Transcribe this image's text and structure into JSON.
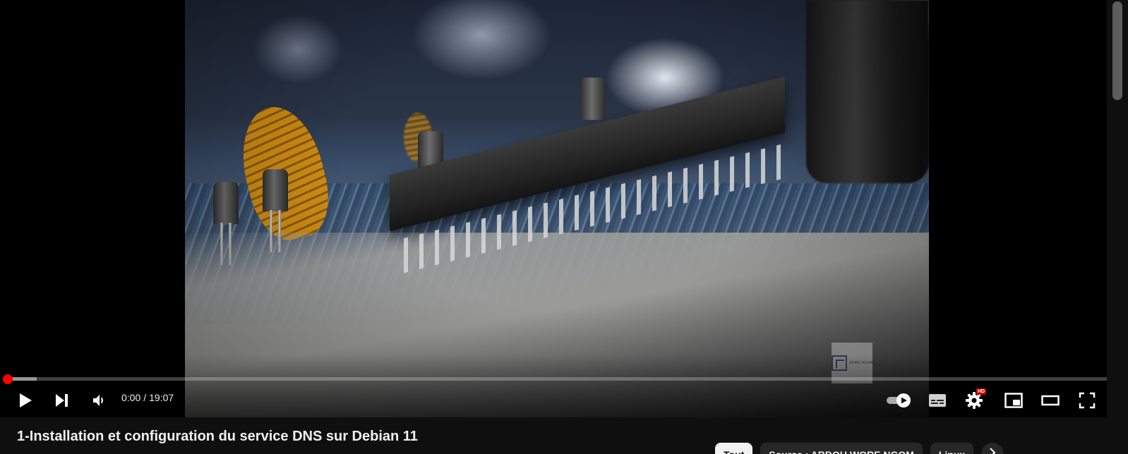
{
  "player": {
    "time_current": "0:00",
    "time_separator": "/",
    "time_total": "19:07",
    "progress_played": 0.004,
    "progress_buffered": 0.026,
    "settings_badge": "HD",
    "accent_color": "#ff0000"
  },
  "video": {
    "title": "1-Installation et configuration du service DNS sur Debian 11"
  },
  "chips": [
    {
      "label": "Tout",
      "active": true
    },
    {
      "label": "Source : ABDOU WORE NGOM",
      "active": false
    },
    {
      "label": "Linux",
      "active": false
    }
  ],
  "icons": {
    "play": "play-icon",
    "next": "next-icon",
    "volume": "volume-icon",
    "autoplay": "autoplay-toggle-icon",
    "captions": "captions-icon",
    "settings": "gear-icon",
    "miniplayer": "miniplayer-icon",
    "theater": "theater-icon",
    "fullscreen": "fullscreen-icon",
    "chips_next": "chevron-right-icon"
  }
}
